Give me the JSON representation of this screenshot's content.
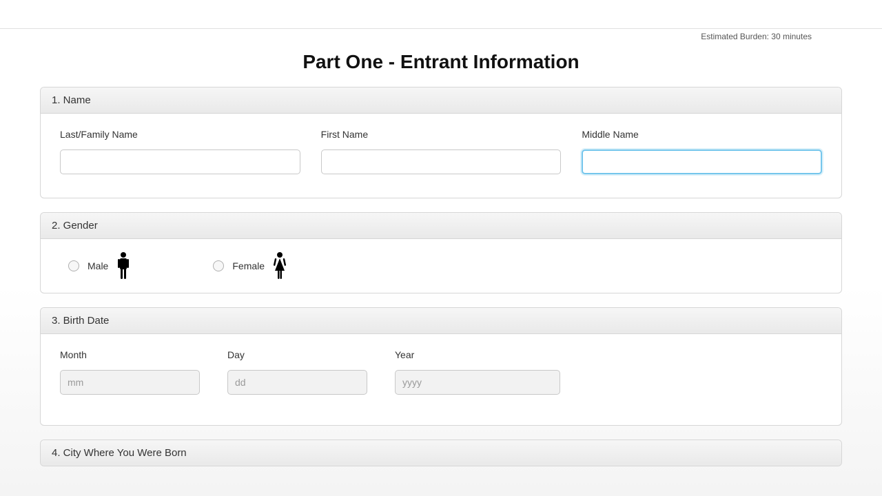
{
  "meta": {
    "burden": "Estimated Burden: 30 minutes"
  },
  "title": "Part One - Entrant Information",
  "sections": {
    "name": {
      "header": "1. Name",
      "last_label": "Last/Family Name",
      "first_label": "First Name",
      "middle_label": "Middle Name",
      "last_value": "",
      "first_value": "",
      "middle_value": ""
    },
    "gender": {
      "header": "2. Gender",
      "male_label": "Male",
      "female_label": "Female",
      "selected": ""
    },
    "birth": {
      "header": "3. Birth Date",
      "month_label": "Month",
      "day_label": "Day",
      "year_label": "Year",
      "month_placeholder": "mm",
      "day_placeholder": "dd",
      "year_placeholder": "yyyy",
      "month_value": "",
      "day_value": "",
      "year_value": ""
    },
    "city": {
      "header": "4. City Where You Were Born"
    }
  }
}
